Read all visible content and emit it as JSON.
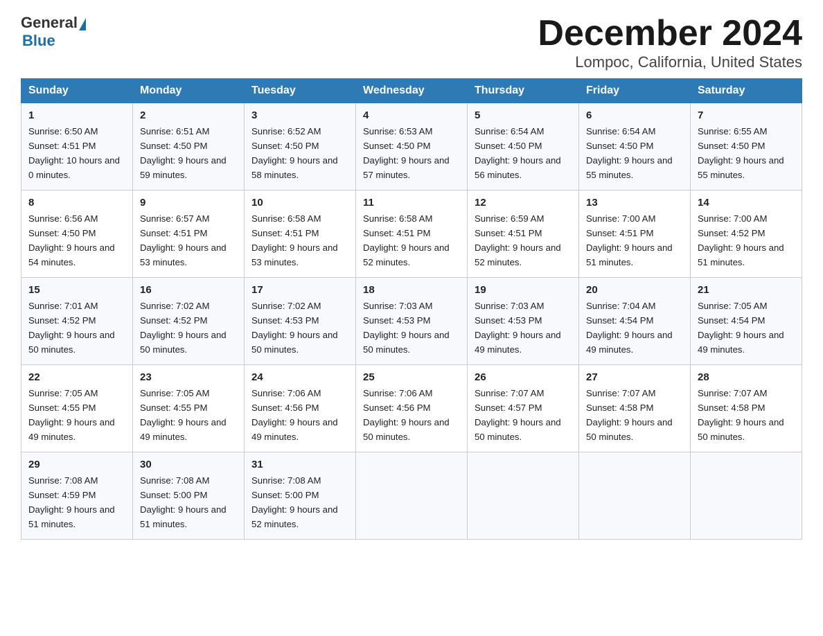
{
  "header": {
    "logo_general": "General",
    "logo_blue": "Blue",
    "month_title": "December 2024",
    "location": "Lompoc, California, United States"
  },
  "days_of_week": [
    "Sunday",
    "Monday",
    "Tuesday",
    "Wednesday",
    "Thursday",
    "Friday",
    "Saturday"
  ],
  "weeks": [
    [
      {
        "day": "1",
        "sunrise": "6:50 AM",
        "sunset": "4:51 PM",
        "daylight": "10 hours and 0 minutes."
      },
      {
        "day": "2",
        "sunrise": "6:51 AM",
        "sunset": "4:50 PM",
        "daylight": "9 hours and 59 minutes."
      },
      {
        "day": "3",
        "sunrise": "6:52 AM",
        "sunset": "4:50 PM",
        "daylight": "9 hours and 58 minutes."
      },
      {
        "day": "4",
        "sunrise": "6:53 AM",
        "sunset": "4:50 PM",
        "daylight": "9 hours and 57 minutes."
      },
      {
        "day": "5",
        "sunrise": "6:54 AM",
        "sunset": "4:50 PM",
        "daylight": "9 hours and 56 minutes."
      },
      {
        "day": "6",
        "sunrise": "6:54 AM",
        "sunset": "4:50 PM",
        "daylight": "9 hours and 55 minutes."
      },
      {
        "day": "7",
        "sunrise": "6:55 AM",
        "sunset": "4:50 PM",
        "daylight": "9 hours and 55 minutes."
      }
    ],
    [
      {
        "day": "8",
        "sunrise": "6:56 AM",
        "sunset": "4:50 PM",
        "daylight": "9 hours and 54 minutes."
      },
      {
        "day": "9",
        "sunrise": "6:57 AM",
        "sunset": "4:51 PM",
        "daylight": "9 hours and 53 minutes."
      },
      {
        "day": "10",
        "sunrise": "6:58 AM",
        "sunset": "4:51 PM",
        "daylight": "9 hours and 53 minutes."
      },
      {
        "day": "11",
        "sunrise": "6:58 AM",
        "sunset": "4:51 PM",
        "daylight": "9 hours and 52 minutes."
      },
      {
        "day": "12",
        "sunrise": "6:59 AM",
        "sunset": "4:51 PM",
        "daylight": "9 hours and 52 minutes."
      },
      {
        "day": "13",
        "sunrise": "7:00 AM",
        "sunset": "4:51 PM",
        "daylight": "9 hours and 51 minutes."
      },
      {
        "day": "14",
        "sunrise": "7:00 AM",
        "sunset": "4:52 PM",
        "daylight": "9 hours and 51 minutes."
      }
    ],
    [
      {
        "day": "15",
        "sunrise": "7:01 AM",
        "sunset": "4:52 PM",
        "daylight": "9 hours and 50 minutes."
      },
      {
        "day": "16",
        "sunrise": "7:02 AM",
        "sunset": "4:52 PM",
        "daylight": "9 hours and 50 minutes."
      },
      {
        "day": "17",
        "sunrise": "7:02 AM",
        "sunset": "4:53 PM",
        "daylight": "9 hours and 50 minutes."
      },
      {
        "day": "18",
        "sunrise": "7:03 AM",
        "sunset": "4:53 PM",
        "daylight": "9 hours and 50 minutes."
      },
      {
        "day": "19",
        "sunrise": "7:03 AM",
        "sunset": "4:53 PM",
        "daylight": "9 hours and 49 minutes."
      },
      {
        "day": "20",
        "sunrise": "7:04 AM",
        "sunset": "4:54 PM",
        "daylight": "9 hours and 49 minutes."
      },
      {
        "day": "21",
        "sunrise": "7:05 AM",
        "sunset": "4:54 PM",
        "daylight": "9 hours and 49 minutes."
      }
    ],
    [
      {
        "day": "22",
        "sunrise": "7:05 AM",
        "sunset": "4:55 PM",
        "daylight": "9 hours and 49 minutes."
      },
      {
        "day": "23",
        "sunrise": "7:05 AM",
        "sunset": "4:55 PM",
        "daylight": "9 hours and 49 minutes."
      },
      {
        "day": "24",
        "sunrise": "7:06 AM",
        "sunset": "4:56 PM",
        "daylight": "9 hours and 49 minutes."
      },
      {
        "day": "25",
        "sunrise": "7:06 AM",
        "sunset": "4:56 PM",
        "daylight": "9 hours and 50 minutes."
      },
      {
        "day": "26",
        "sunrise": "7:07 AM",
        "sunset": "4:57 PM",
        "daylight": "9 hours and 50 minutes."
      },
      {
        "day": "27",
        "sunrise": "7:07 AM",
        "sunset": "4:58 PM",
        "daylight": "9 hours and 50 minutes."
      },
      {
        "day": "28",
        "sunrise": "7:07 AM",
        "sunset": "4:58 PM",
        "daylight": "9 hours and 50 minutes."
      }
    ],
    [
      {
        "day": "29",
        "sunrise": "7:08 AM",
        "sunset": "4:59 PM",
        "daylight": "9 hours and 51 minutes."
      },
      {
        "day": "30",
        "sunrise": "7:08 AM",
        "sunset": "5:00 PM",
        "daylight": "9 hours and 51 minutes."
      },
      {
        "day": "31",
        "sunrise": "7:08 AM",
        "sunset": "5:00 PM",
        "daylight": "9 hours and 52 minutes."
      },
      null,
      null,
      null,
      null
    ]
  ]
}
